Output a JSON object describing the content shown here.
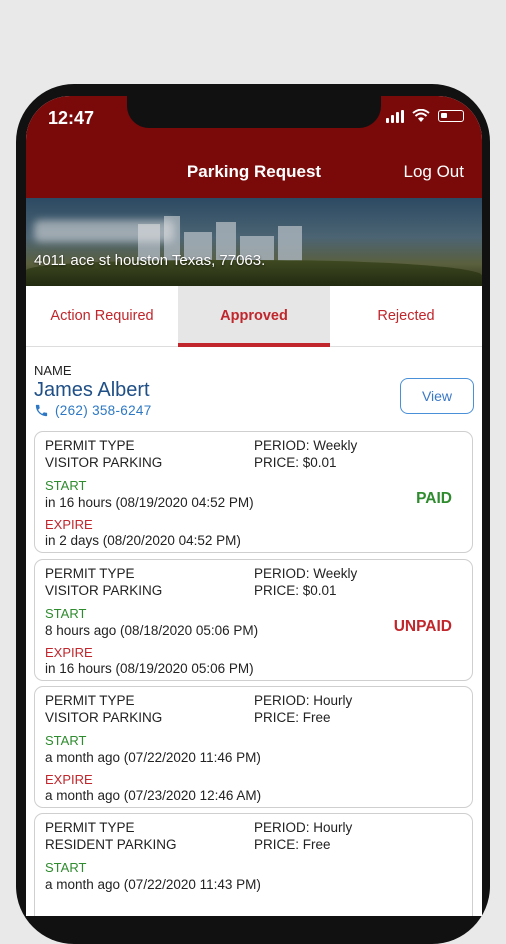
{
  "status_bar": {
    "time": "12:47"
  },
  "nav": {
    "title": "Parking Request",
    "logout_label": "Log Out"
  },
  "banner": {
    "address": "4011 ace st houston Texas, 77063."
  },
  "tabs": [
    {
      "label": "Action Required"
    },
    {
      "label": "Approved"
    },
    {
      "label": "Rejected"
    }
  ],
  "request": {
    "name_label": "NAME",
    "name": "James Albert",
    "phone": "(262) 358-6247",
    "view_label": "View"
  },
  "permits": [
    {
      "type_label": "PERMIT TYPE",
      "type": "VISITOR PARKING",
      "period": "PERIOD: Weekly",
      "price": "PRICE: $0.01",
      "start_label": "START",
      "start": "in 16 hours (08/19/2020 04:52 PM)",
      "expire_label": "EXPIRE",
      "expire": "in 2 days (08/20/2020 04:52 PM)",
      "status": "PAID"
    },
    {
      "type_label": "PERMIT TYPE",
      "type": "VISITOR PARKING",
      "period": "PERIOD: Weekly",
      "price": "PRICE: $0.01",
      "start_label": "START",
      "start": "8 hours ago (08/18/2020 05:06 PM)",
      "expire_label": "EXPIRE",
      "expire": "in 16 hours (08/19/2020 05:06 PM)",
      "status": "UNPAID"
    },
    {
      "type_label": "PERMIT TYPE",
      "type": "VISITOR PARKING",
      "period": "PERIOD: Hourly",
      "price": "PRICE: Free",
      "start_label": "START",
      "start": "a month ago (07/22/2020 11:46 PM)",
      "expire_label": "EXPIRE",
      "expire": "a month ago (07/23/2020 12:46 AM)",
      "status": ""
    },
    {
      "type_label": "PERMIT TYPE",
      "type": "RESIDENT PARKING",
      "period": "PERIOD: Hourly",
      "price": "PRICE: Free",
      "start_label": "START",
      "start": "a month ago (07/22/2020 11:43 PM)",
      "expire_label": "",
      "expire": "",
      "status": ""
    }
  ],
  "colors": {
    "header": "#7a0a0a",
    "accent_red": "#c0262b",
    "green": "#2e8b2e",
    "link_blue": "#2d78c4"
  }
}
